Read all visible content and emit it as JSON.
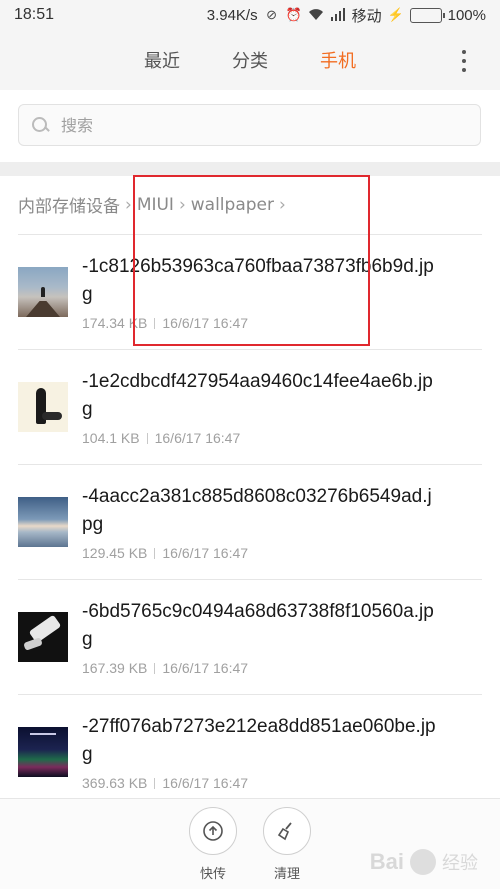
{
  "status_bar": {
    "time": "18:51",
    "network_speed": "3.94K/s",
    "carrier": "移动",
    "battery_level": 1.0,
    "battery_text": "100%",
    "battery_color": "#2fbf2f"
  },
  "header": {
    "tabs": [
      {
        "label": "最近",
        "active": false
      },
      {
        "label": "分类",
        "active": false
      },
      {
        "label": "手机",
        "active": true
      }
    ],
    "accent_color": "#f26d21",
    "more_icon": "more-vertical-icon"
  },
  "search": {
    "placeholder": "搜索",
    "icon": "search-icon"
  },
  "breadcrumb": {
    "items": [
      "内部存储设备",
      "MIUI",
      "wallpaper"
    ],
    "separator_icon": "chevron-right-icon"
  },
  "files": [
    {
      "name": "-1c8126b53963ca760fbaa73873fb6b9d.jpg",
      "size": "174.34 KB",
      "date": "16/6/17 16:47",
      "thumbnail": "pier-sunset"
    },
    {
      "name": "-1e2cdbcdf427954aa9460c14fee4ae6b.jpg",
      "size": "104.1 KB",
      "date": "16/6/17 16:47",
      "thumbnail": "girl-with-dog"
    },
    {
      "name": "-4aacc2a381c885d8608c03276b6549ad.jpg",
      "size": "129.45 KB",
      "date": "16/6/17 16:47",
      "thumbnail": "sea-horizon"
    },
    {
      "name": "-6bd5765c9c0494a68d63738f8f10560a.jpg",
      "size": "167.39 KB",
      "date": "16/6/17 16:47",
      "thumbnail": "dark-hands"
    },
    {
      "name": "-27ff076ab7273e212ea8dd851ae060be.jpg",
      "size": "369.63 KB",
      "date": "16/6/17 16:47",
      "thumbnail": "aurora-night"
    }
  ],
  "bottom_bar": {
    "quick_transfer": {
      "label": "快传",
      "icon": "upload-circle-icon"
    },
    "clean": {
      "label": "清理",
      "icon": "broom-icon"
    }
  },
  "annotation_color": "#e0282e",
  "watermark": {
    "brand": "Bai",
    "text": "经验"
  }
}
